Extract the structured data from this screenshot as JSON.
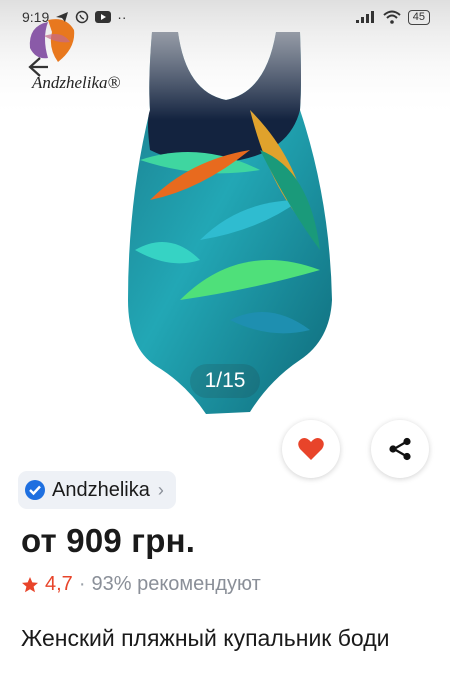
{
  "status_bar": {
    "time": "9:19",
    "battery": "45"
  },
  "header": {
    "brand_logo_text": "Andzhelika"
  },
  "gallery": {
    "counter": "1/15"
  },
  "brand": {
    "name": "Andzhelika"
  },
  "product": {
    "price": "от 909 грн.",
    "rating": "4,7",
    "separator": "·",
    "recommend": "93% рекомендуют",
    "title": "Женский пляжный купальник боди"
  },
  "colors": {
    "accent_red": "#e8442a",
    "verified_blue": "#1e6fe0"
  }
}
